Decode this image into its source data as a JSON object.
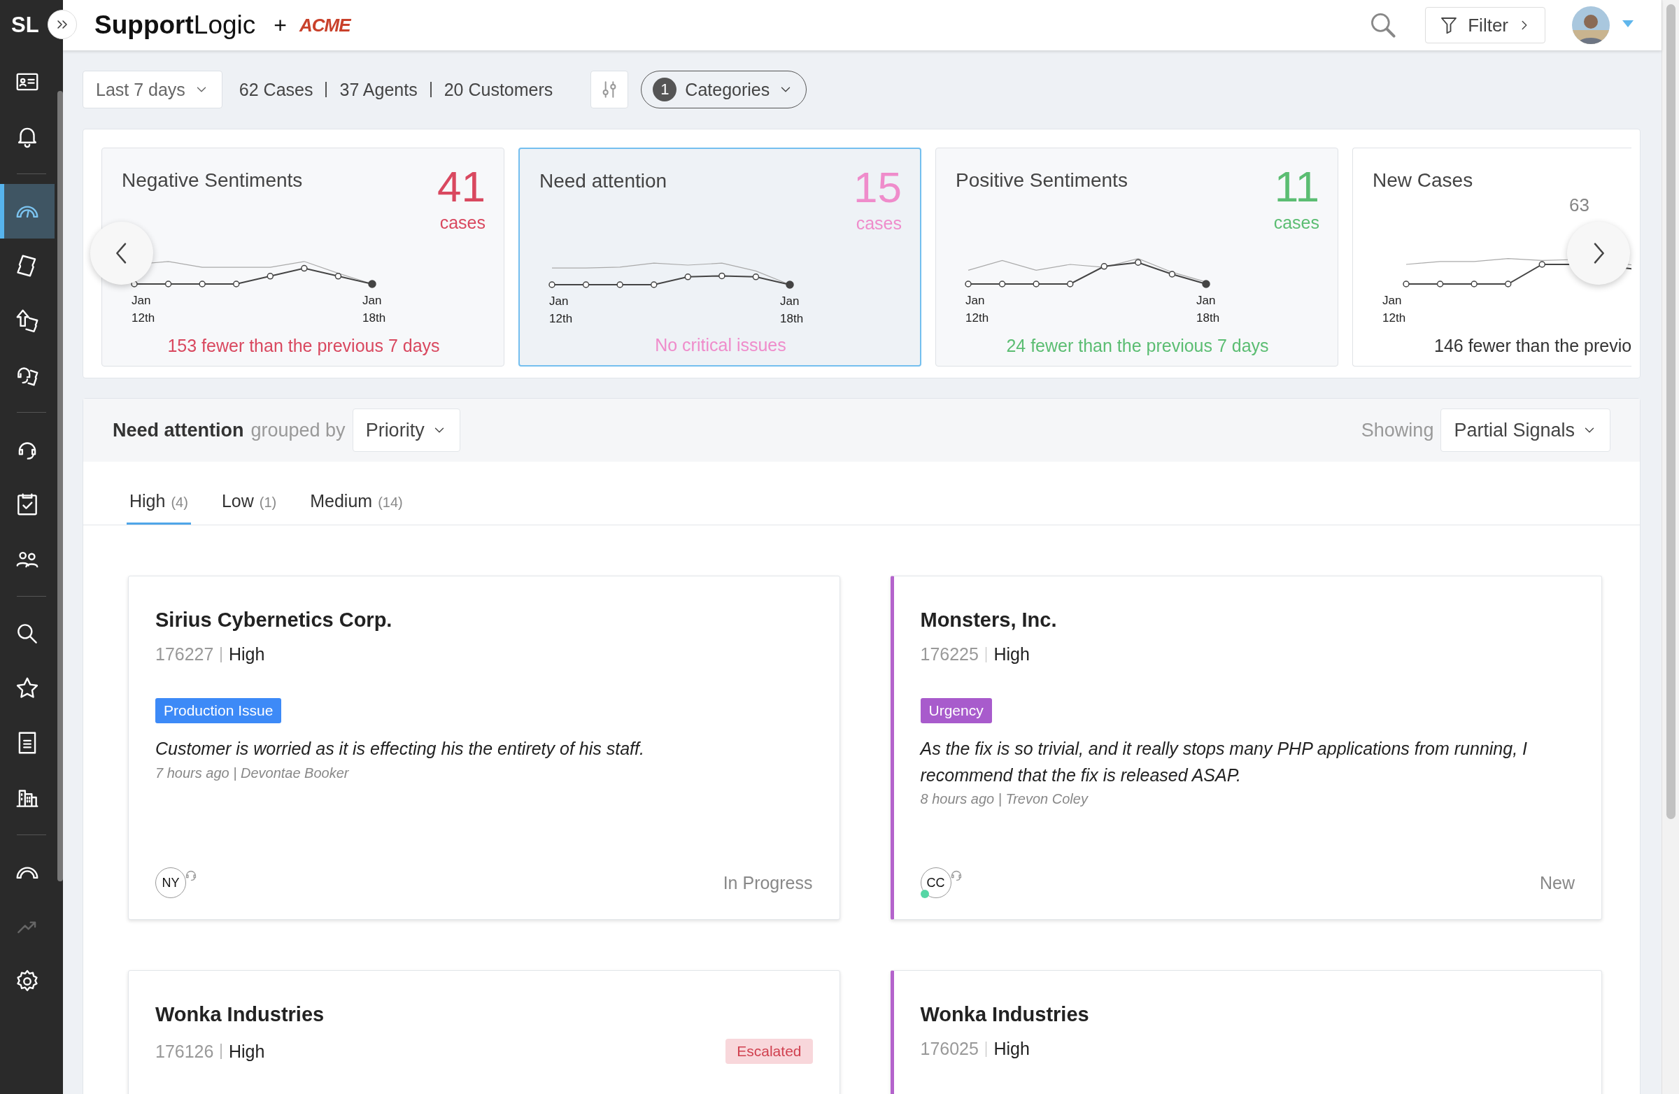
{
  "sidebar": {
    "logo": "SL",
    "groups": [
      [
        {
          "selected": false,
          "disabled": false
        },
        {
          "selected": false,
          "disabled": false
        }
      ],
      [
        {
          "selected": true,
          "disabled": false
        },
        {
          "selected": false,
          "disabled": false
        },
        {
          "selected": false,
          "disabled": false
        },
        {
          "selected": false,
          "disabled": false
        }
      ],
      [
        {
          "selected": false,
          "disabled": false
        },
        {
          "selected": false,
          "disabled": false
        },
        {
          "selected": false,
          "disabled": false
        }
      ],
      [
        {
          "selected": false,
          "disabled": false
        },
        {
          "selected": false,
          "disabled": false
        },
        {
          "selected": false,
          "disabled": false
        },
        {
          "selected": false,
          "disabled": false
        }
      ],
      [
        {
          "selected": false,
          "disabled": false
        },
        {
          "selected": false,
          "disabled": true
        },
        {
          "selected": false,
          "disabled": false
        }
      ]
    ]
  },
  "header": {
    "brand": "**Support**Logic",
    "plus": "+",
    "partner": "ACME",
    "filter_button": "Filter"
  },
  "filters": {
    "range": "Last 7 days",
    "counts": [
      "62 Cases",
      "37 Agents",
      "20 Customers"
    ],
    "categories": {
      "count": "1",
      "label": "Categories"
    }
  },
  "stat_cards": [
    {
      "title": "Negative Sentiments",
      "number": "41",
      "unit": "cases",
      "color": "#d9485f",
      "selected": false,
      "faded": false,
      "x_labels": [
        "Jan 12th",
        "Jan 18th"
      ],
      "footer": "153 fewer than the previous 7 days"
    },
    {
      "title": "Need attention",
      "number": "15",
      "unit": "cases",
      "color": "#ef8ccb",
      "selected": true,
      "faded": false,
      "x_labels": [
        "Jan 12th",
        "Jan 18th"
      ],
      "footer": "No critical issues"
    },
    {
      "title": "Positive Sentiments",
      "number": "11",
      "unit": "cases",
      "color": "#5bbd72",
      "selected": false,
      "faded": false,
      "x_labels": [
        "Jan 12th",
        "Jan 18th"
      ],
      "footer": "24 fewer than the previous 7 days"
    },
    {
      "title": "New Cases",
      "number": "63",
      "color": "#333333",
      "selected": false,
      "faded": true,
      "x_labels": [
        "Jan 12th"
      ],
      "footer": "146 fewer than the previo"
    }
  ],
  "group": {
    "title": "Need attention",
    "grouped_by": "grouped by",
    "group_select": "Priority",
    "showing": "Showing",
    "showing_select": "Partial Signals",
    "tabs": [
      {
        "label": "High",
        "count": "(4)",
        "selected": true
      },
      {
        "label": "Low",
        "count": "(1)",
        "selected": false
      },
      {
        "label": "Medium",
        "count": "(14)",
        "selected": false
      }
    ],
    "cases": [
      {
        "company": "Sirius Cybernetics Corp.",
        "id": "176227",
        "priority": "High",
        "flagged": false,
        "tag": {
          "label": "Production Issue",
          "color": "#3d8af7"
        },
        "message": "Customer is worried as it is effecting his the entirety of his staff.",
        "meta": "7 hours ago | Devontae Booker",
        "assignee": "NY",
        "online": false,
        "status": "In Progress"
      },
      {
        "company": "Monsters, Inc.",
        "id": "176225",
        "priority": "High",
        "flagged": true,
        "tag": {
          "label": "Urgency",
          "color": "#a85bcc"
        },
        "message": "As the fix is so trivial, and it really stops many PHP applications from running, I recommend that the fix is released ASAP.",
        "meta": "8 hours ago | Trevon Coley",
        "assignee": "CC",
        "online": true,
        "status": "New"
      },
      {
        "company": "Wonka Industries",
        "id": "176126",
        "priority": "High",
        "flagged": false,
        "badge": "Escalated"
      },
      {
        "company": "Wonka Industries",
        "id": "176025",
        "priority": "High",
        "flagged": true
      }
    ]
  }
}
